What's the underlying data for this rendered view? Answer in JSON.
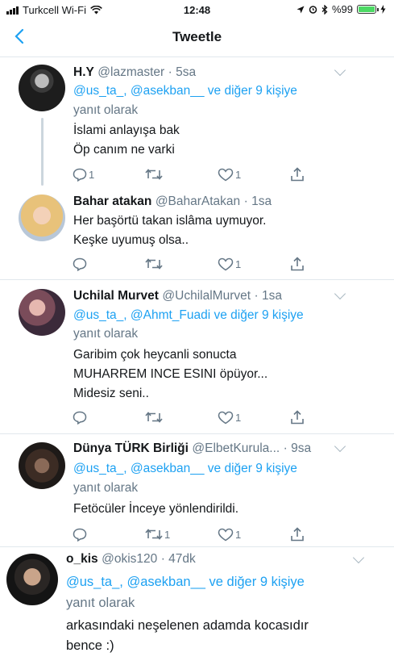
{
  "status_bar": {
    "carrier": "Turkcell Wi-Fi",
    "time": "12:48",
    "battery": "%99"
  },
  "nav": {
    "title": "Tweetle",
    "back_icon": "chevron-left-icon"
  },
  "colors": {
    "accent": "#1da1f2",
    "muted": "#657786",
    "battery": "#4cd964"
  },
  "tweets": [
    {
      "name": "H.Y",
      "handle": "@lazmaster",
      "time": "· 5sa",
      "reply_to": "@us_ta_, @asekban__ ve diğer 9 kişiye",
      "reply_label": "yanıt olarak",
      "text": "İslami anlayışa bak\nÖp canım ne varki",
      "replies": "1",
      "retweets": "",
      "likes": "1"
    },
    {
      "name": "Bahar atakan",
      "handle": "@BaharAtakan",
      "time": "· 1sa",
      "text": "Her başörtü takan islâma uymuyor.\nKeşke uyumuş olsa..",
      "replies": "",
      "retweets": "",
      "likes": "1"
    },
    {
      "name": "Uchilal Murvet",
      "handle": "@UchilalMurvet",
      "time": "· 1sa",
      "reply_to": "@us_ta_, @Ahmt_Fuadi ve diğer 9 kişiye",
      "reply_label": "yanıt olarak",
      "text": "Garibim çok heycanli sonucta\nMUHARREM INCE ESINI öpüyor...\nMidesiz seni..",
      "replies": "",
      "retweets": "",
      "likes": "1"
    },
    {
      "name": "Dünya TÜRK Birliği",
      "handle": "@ElbetKurula...",
      "time": "· 9sa",
      "reply_to": "@us_ta_, @asekban__ ve diğer 9 kişiye",
      "reply_label": "yanıt olarak",
      "text": "Fetöcüler İnceye yönlendirildi.",
      "replies": "",
      "retweets": "1",
      "likes": "1"
    },
    {
      "name": "o_kis",
      "handle": "@okis120",
      "time": "· 47dk",
      "reply_to": "@us_ta_, @asekban__ ve diğer 9 kişiye",
      "reply_label": "yanıt olarak",
      "text": "arkasındaki neşelenen adamda kocasıdır\nbence :)"
    }
  ]
}
